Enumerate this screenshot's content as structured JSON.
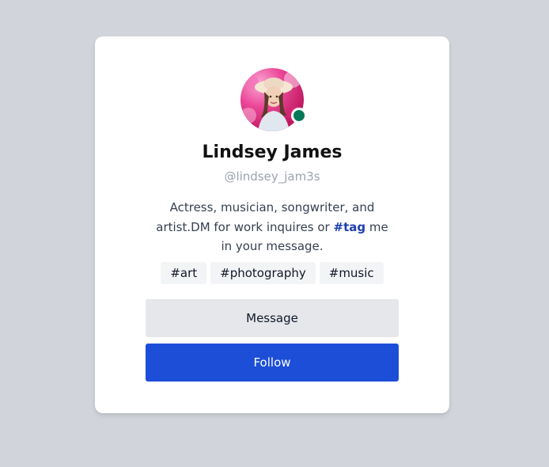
{
  "profile": {
    "name": "Lindsey James",
    "handle": "@lindsey_jam3s",
    "status": "online",
    "bio_part1": "Actress, musician, songwriter, and artist.DM for work inquires or ",
    "bio_tag": "#tag",
    "bio_part2": " me in your message."
  },
  "tags": [
    "#art",
    "#photography",
    "#music"
  ],
  "actions": {
    "message_label": "Message",
    "follow_label": "Follow"
  },
  "colors": {
    "page_bg": "#d1d5db",
    "follow_bg": "#1d4ed8",
    "message_bg": "#e5e7eb",
    "status_online": "#047857",
    "tag_link": "#1e40af"
  }
}
